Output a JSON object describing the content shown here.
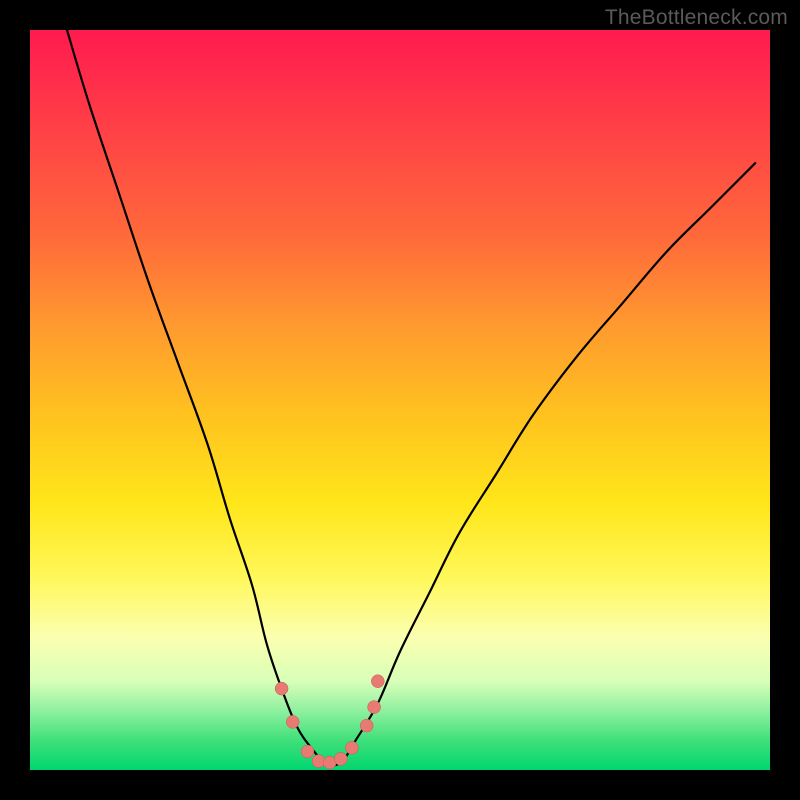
{
  "watermark": "TheBottleneck.com",
  "chart_data": {
    "type": "line",
    "title": "",
    "xlabel": "",
    "ylabel": "",
    "xlim": [
      0,
      100
    ],
    "ylim": [
      0,
      100
    ],
    "background_gradient": {
      "top": "#ff1a4f",
      "mid": "#ffe61a",
      "bottom": "#00d670"
    },
    "series": [
      {
        "name": "bottleneck-curve",
        "x": [
          5,
          8,
          12,
          16,
          20,
          24,
          27,
          30,
          32,
          34,
          36,
          38,
          40,
          42,
          44,
          47,
          50,
          54,
          58,
          63,
          68,
          74,
          80,
          86,
          92,
          98
        ],
        "values": [
          100,
          90,
          78,
          66,
          55,
          44,
          34,
          25,
          17,
          11,
          6,
          3,
          1,
          1,
          4,
          9,
          16,
          24,
          32,
          40,
          48,
          56,
          63,
          70,
          76,
          82
        ]
      }
    ],
    "markers": {
      "name": "highlight-dots",
      "color": "#e77a72",
      "points": [
        {
          "x": 34.0,
          "y": 11.0
        },
        {
          "x": 35.5,
          "y": 6.5
        },
        {
          "x": 37.5,
          "y": 2.5
        },
        {
          "x": 39.0,
          "y": 1.2
        },
        {
          "x": 40.5,
          "y": 1.0
        },
        {
          "x": 42.0,
          "y": 1.5
        },
        {
          "x": 43.5,
          "y": 3.0
        },
        {
          "x": 45.5,
          "y": 6.0
        },
        {
          "x": 46.5,
          "y": 8.5
        },
        {
          "x": 47.0,
          "y": 12.0
        }
      ]
    }
  }
}
